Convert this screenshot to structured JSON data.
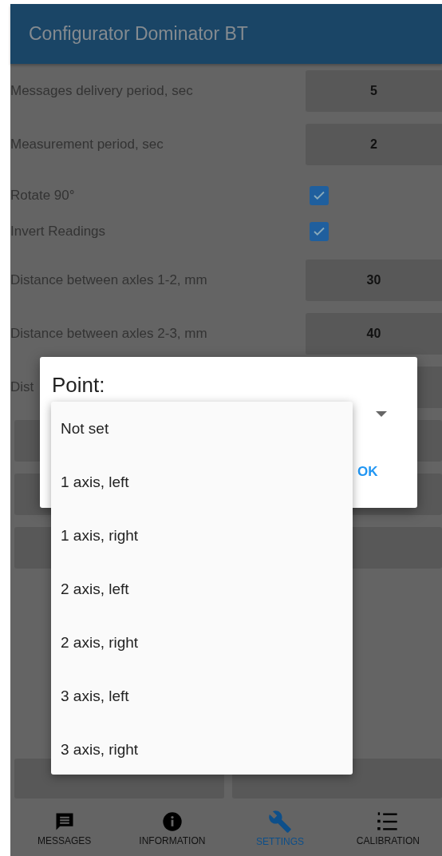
{
  "app_bar": {
    "title": "Configurator Dominator BT"
  },
  "settings": [
    {
      "kind": "field",
      "label": "Messages delivery period, sec",
      "value": "5"
    },
    {
      "kind": "field",
      "label": "Measurement period, sec",
      "value": "2"
    },
    {
      "kind": "checkbox",
      "label": "Rotate 90°",
      "checked": true
    },
    {
      "kind": "checkbox",
      "label": "Invert Readings",
      "checked": true
    },
    {
      "kind": "field",
      "label": "Distance between axles 1-2, mm",
      "value": "30"
    },
    {
      "kind": "field",
      "label": "Distance between axles 2-3, mm",
      "value": "40"
    },
    {
      "kind": "field",
      "label": "Dist"
    }
  ],
  "dialog": {
    "title": "Point:",
    "ok_button": "OK"
  },
  "dropdown_menu": [
    {
      "label": "Not set",
      "selected": false
    },
    {
      "label": "1 axis, left",
      "selected": false
    },
    {
      "label": "1 axis, right",
      "selected": false
    },
    {
      "label": "2 axis, left",
      "selected": false
    },
    {
      "label": "2 axis, right",
      "selected": false
    },
    {
      "label": "3 axis, left",
      "selected": false
    },
    {
      "label": "3 axis, right",
      "selected": false
    }
  ],
  "bottom_nav": [
    {
      "kind": "messages",
      "label": "MESSAGES",
      "selected": false
    },
    {
      "kind": "information",
      "label": "INFORMATION",
      "selected": false
    },
    {
      "kind": "settings",
      "label": "SETTINGS",
      "selected": true
    },
    {
      "kind": "calibration",
      "label": "CALIBRATION",
      "selected": false
    }
  ]
}
